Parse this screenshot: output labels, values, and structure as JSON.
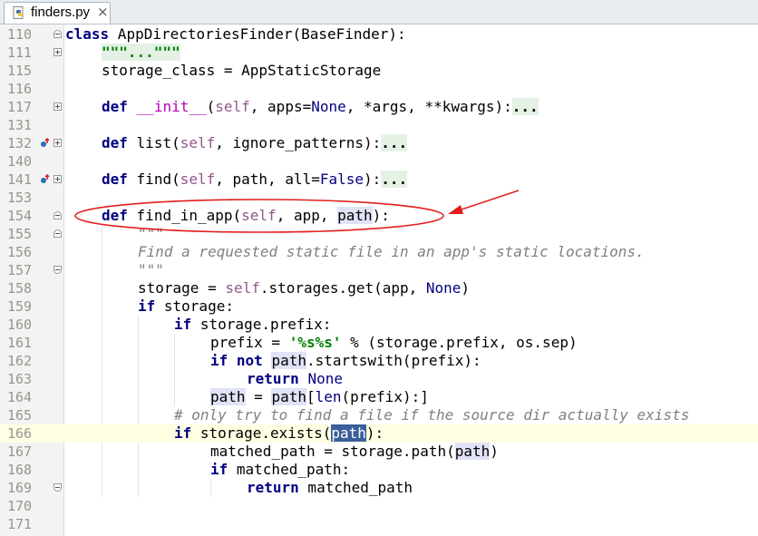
{
  "tab": {
    "filename": "finders.py",
    "close_glyph": "×",
    "icon": "python-file-icon"
  },
  "colors": {
    "annotation": "#e02020",
    "keyword": "#000080",
    "self": "#94558d",
    "string": "#008000",
    "docstring": "#808080"
  },
  "lines": [
    {
      "num": "110"
    },
    {
      "num": "111",
      "fold_text": "\"\"\"...\"\"\""
    },
    {
      "num": "115",
      "text": "storage_class = AppStaticStorage"
    },
    {
      "num": "116"
    },
    {
      "num": "117",
      "def_kw": "def",
      "name": "__init__",
      "open": "(",
      "self_kw": "self",
      "args_a": ", apps=",
      "none_kw": "None",
      "args_b": ", *args, **kwargs):",
      "ellipsis": "..."
    },
    {
      "num": "131"
    },
    {
      "num": "132",
      "def_kw": "def",
      "name": "list",
      "open": "(",
      "self_kw": "self",
      "args_a": ", ignore_patterns):",
      "ellipsis": "..."
    },
    {
      "num": "140"
    },
    {
      "num": "141",
      "def_kw": "def",
      "name": "find",
      "open": "(",
      "self_kw": "self",
      "args_a": ", path, all=",
      "false_kw": "False",
      "args_b": "):",
      "ellipsis": "..."
    },
    {
      "num": "153"
    },
    {
      "num": "154",
      "def_kw": "def",
      "name": "find_in_app",
      "open": "(",
      "self_kw": "self",
      "args_a": ", app, ",
      "path": "path",
      "close": "):"
    },
    {
      "num": "155",
      "doc": "\"\"\""
    },
    {
      "num": "156",
      "doc": "Find a requested static file in an app's static locations."
    },
    {
      "num": "157",
      "doc": "\"\"\""
    },
    {
      "num": "158",
      "a": "storage = ",
      "self_kw": "self",
      "b": ".storages.get(app, ",
      "none_kw": "None",
      "c": ")"
    },
    {
      "num": "159",
      "if_kw": "if",
      "a": " storage:"
    },
    {
      "num": "160",
      "if_kw": "if",
      "a": " storage.prefix:"
    },
    {
      "num": "161",
      "a": "prefix = ",
      "str": "'%s%s'",
      "b": " % (storage.prefix, os.sep)"
    },
    {
      "num": "162",
      "if_kw": "if not",
      "path": "path",
      "a": ".startswith(prefix):"
    },
    {
      "num": "163",
      "ret_kw": "return",
      "none_kw": "None"
    },
    {
      "num": "164",
      "path": "path",
      "a": " = ",
      "path2": "path",
      "b": "[",
      "len": "len",
      "c": "(prefix):]"
    },
    {
      "num": "165",
      "comment": "# only try to find a file if the source dir actually exists"
    },
    {
      "num": "166",
      "if_kw": "if",
      "a": " storage.exists(",
      "path": "path",
      "b": "):"
    },
    {
      "num": "167",
      "a": "matched_path = storage.path(",
      "path": "path",
      "b": ")"
    },
    {
      "num": "168",
      "if_kw": "if",
      "a": " matched_path:"
    },
    {
      "num": "169",
      "ret_kw": "return",
      "a": " matched_path"
    },
    {
      "num": "170"
    },
    {
      "num": "171"
    }
  ],
  "line110": {
    "class_kw": "class",
    "rest": " AppDirectoriesFinder(BaseFinder):"
  }
}
